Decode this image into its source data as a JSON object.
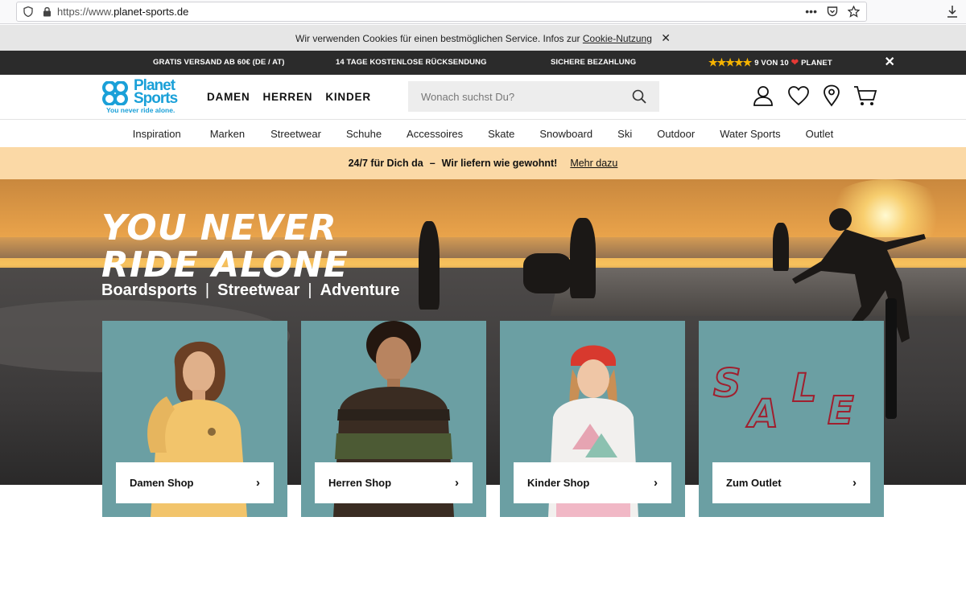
{
  "browser": {
    "url_prefix": "https://www.",
    "url_domain": "planet-sports.de",
    "menu_dots": "•••"
  },
  "cookie": {
    "text": "Wir verwenden Cookies für einen bestmöglichen Service. Infos zur ",
    "link": "Cookie-Nutzung",
    "close": "✕"
  },
  "usp": {
    "shipping": "GRATIS VERSAND AB 60€ (DE / AT)",
    "returns": "14 TAGE KOSTENLOSE RÜCKSENDUNG",
    "payment": "SICHERE BEZAHLUNG",
    "stars": "★★★★★",
    "rating_text": "9 VON 10",
    "rating_brand": "PLANET",
    "close": "✕"
  },
  "header": {
    "logo_line1": "Planet",
    "logo_line2": "Sports",
    "logo_tagline": "You never ride alone.",
    "nav": [
      "DAMEN",
      "HERREN",
      "KINDER"
    ],
    "search_placeholder": "Wonach suchst Du?"
  },
  "categories": [
    "Inspiration",
    "Marken",
    "Streetwear",
    "Schuhe",
    "Accessoires",
    "Skate",
    "Snowboard",
    "Ski",
    "Outdoor",
    "Water Sports",
    "Outlet"
  ],
  "promo": {
    "part1": "24/7 für Dich da",
    "sep": "–",
    "part2": "Wir liefern wie gewohnt!",
    "link": "Mehr dazu"
  },
  "hero": {
    "title_line1": "YOU NEVER",
    "title_line2": "RIDE ALONE",
    "sub1": "Boardsports",
    "sub2": "Streetwear",
    "sub3": "Adventure",
    "pipe": "|"
  },
  "tiles": [
    {
      "label": "Damen Shop"
    },
    {
      "label": "Herren Shop"
    },
    {
      "label": "Kinder Shop"
    },
    {
      "label": "Zum Outlet"
    }
  ],
  "tile_chevron": "›",
  "sale": {
    "s": "S",
    "a": "A",
    "l": "L",
    "e": "E"
  },
  "colors": {
    "brand_blue": "#1aa0d8",
    "usp_bar": "#2b2b2b",
    "promo_bar": "#fbd9a6",
    "tile_teal": "#6b9fa3",
    "star_gold": "#f5b301",
    "heart_red": "#e53935"
  }
}
